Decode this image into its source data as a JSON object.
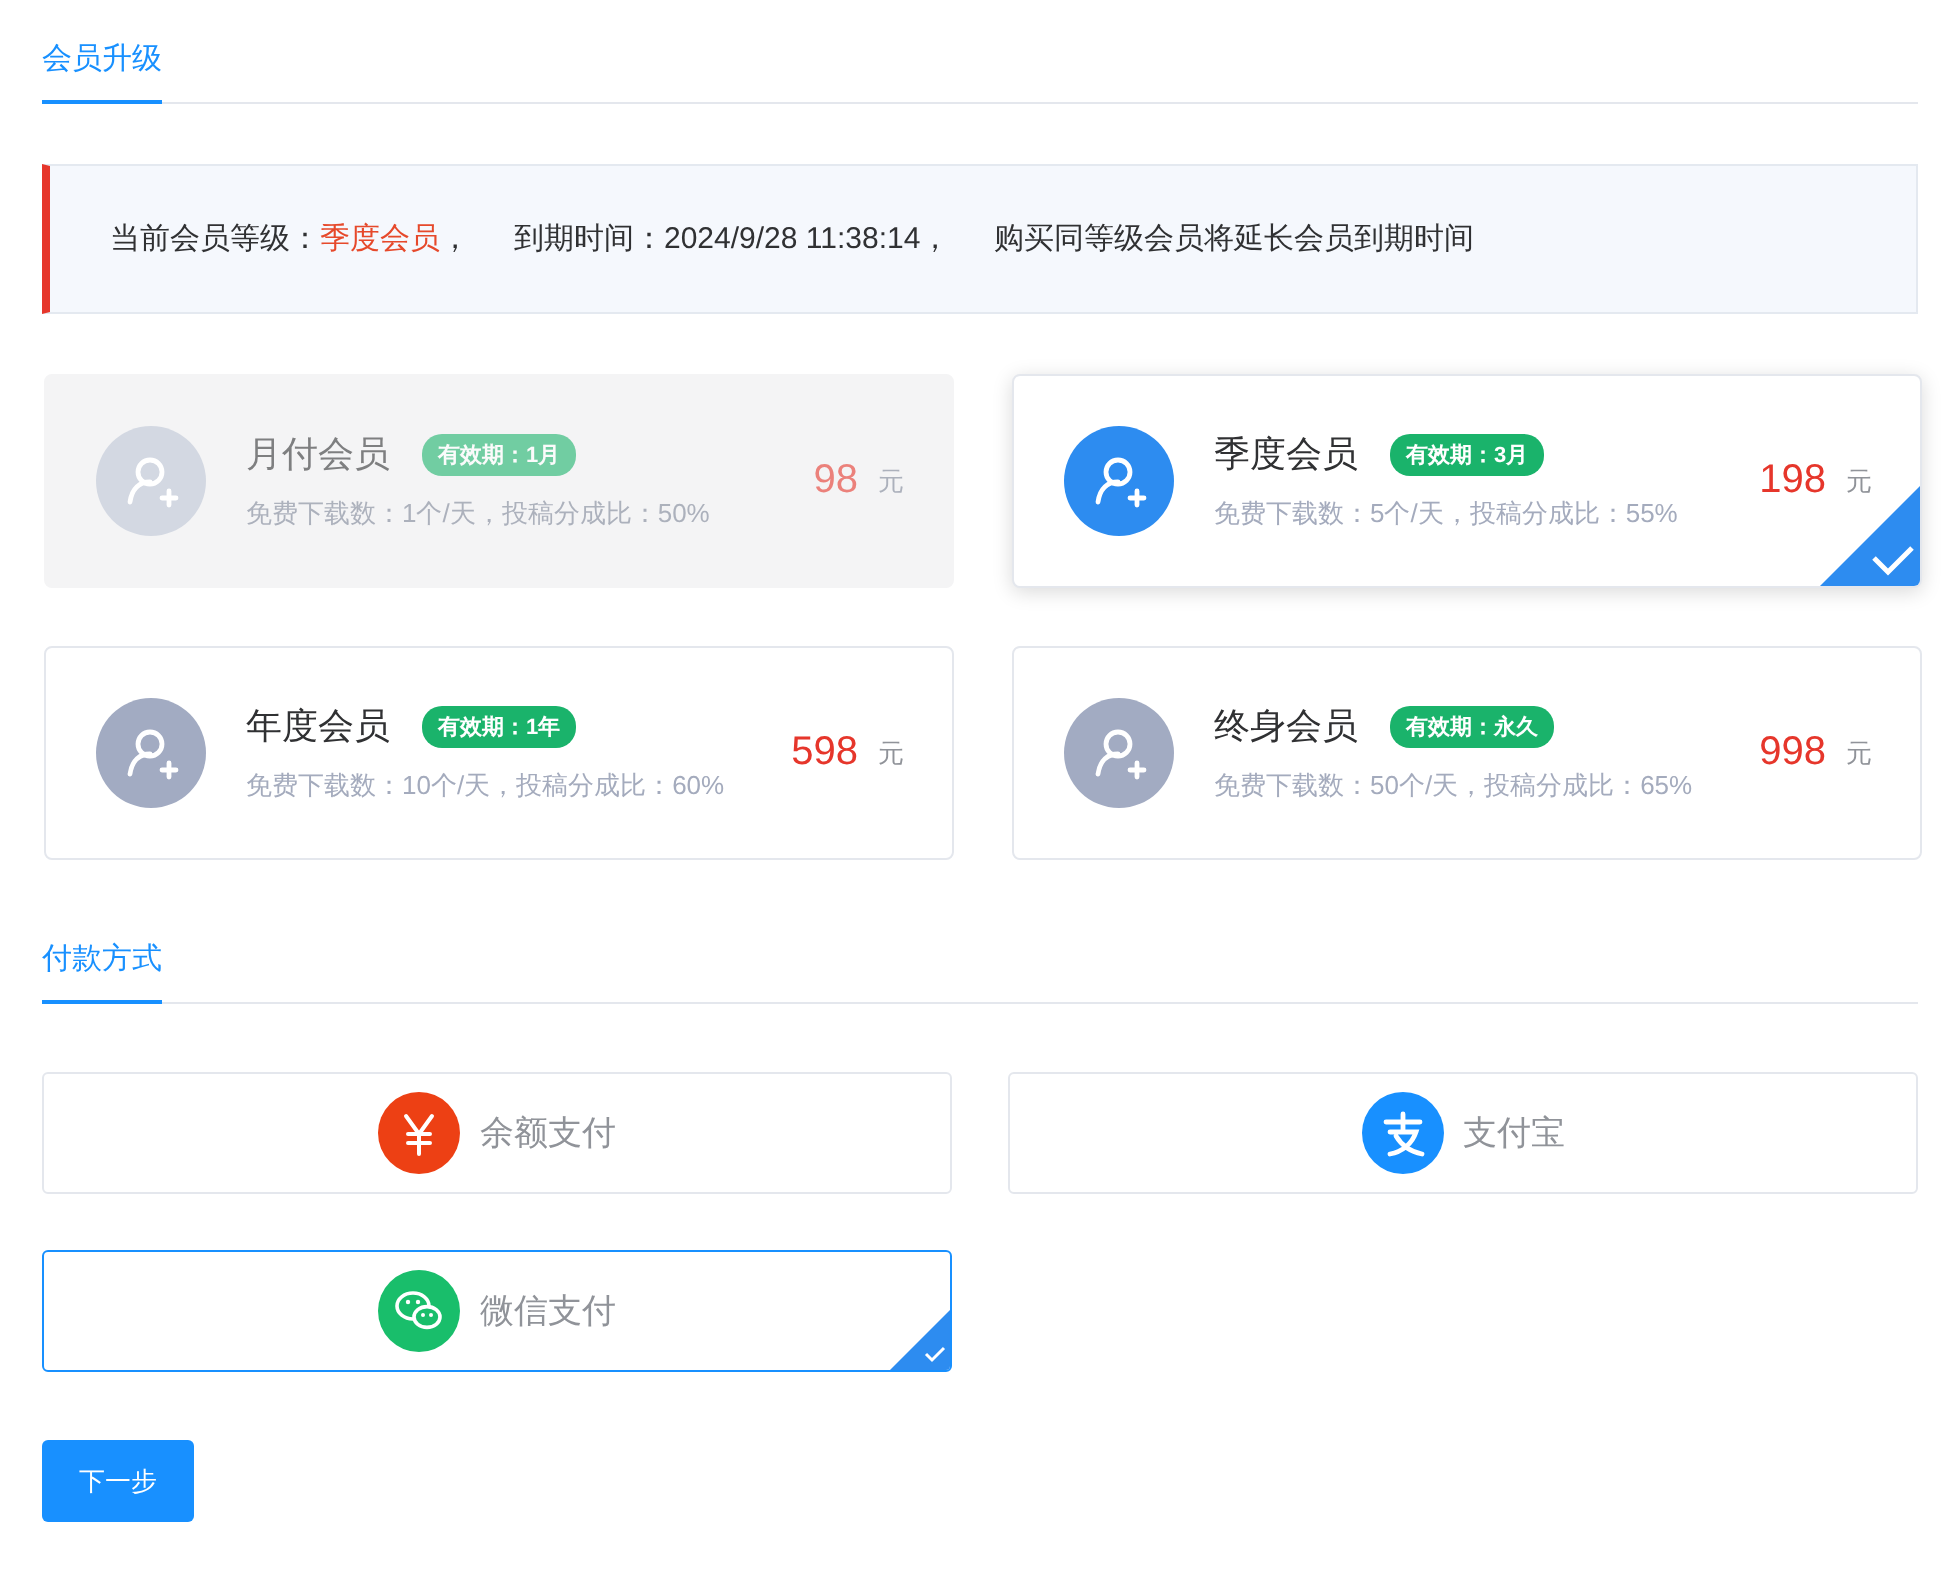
{
  "upgrade_tab": {
    "label": "会员升级",
    "selected": true
  },
  "notice": {
    "level_label": "当前会员等级：",
    "level_value": "季度会员",
    "level_suffix": "，",
    "expiry": "到期时间：2024/9/28 11:38:14，",
    "note": "购买同等级会员将延长会员到期时间"
  },
  "plans": [
    {
      "name": "月付会员",
      "validity": "有效期：1月",
      "benefits": "免费下载数：1个/天，投稿分成比：50%",
      "price": "98",
      "unit": "元",
      "disabled": true,
      "selected": false
    },
    {
      "name": "季度会员",
      "validity": "有效期：3月",
      "benefits": "免费下载数：5个/天，投稿分成比：55%",
      "price": "198",
      "unit": "元",
      "disabled": false,
      "selected": true
    },
    {
      "name": "年度会员",
      "validity": "有效期：1年",
      "benefits": "免费下载数：10个/天，投稿分成比：60%",
      "price": "598",
      "unit": "元",
      "disabled": false,
      "selected": false
    },
    {
      "name": "终身会员",
      "validity": "有效期：永久",
      "benefits": "免费下载数：50个/天，投稿分成比：65%",
      "price": "998",
      "unit": "元",
      "disabled": false,
      "selected": false
    }
  ],
  "payment_tab": {
    "label": "付款方式",
    "selected": true
  },
  "payment_methods": [
    {
      "kind": "balance",
      "label": "余额支付",
      "selected": false
    },
    {
      "kind": "alipay",
      "label": "支付宝",
      "selected": false
    },
    {
      "kind": "wechat",
      "label": "微信支付",
      "selected": true
    }
  ],
  "next_button": "下一步"
}
